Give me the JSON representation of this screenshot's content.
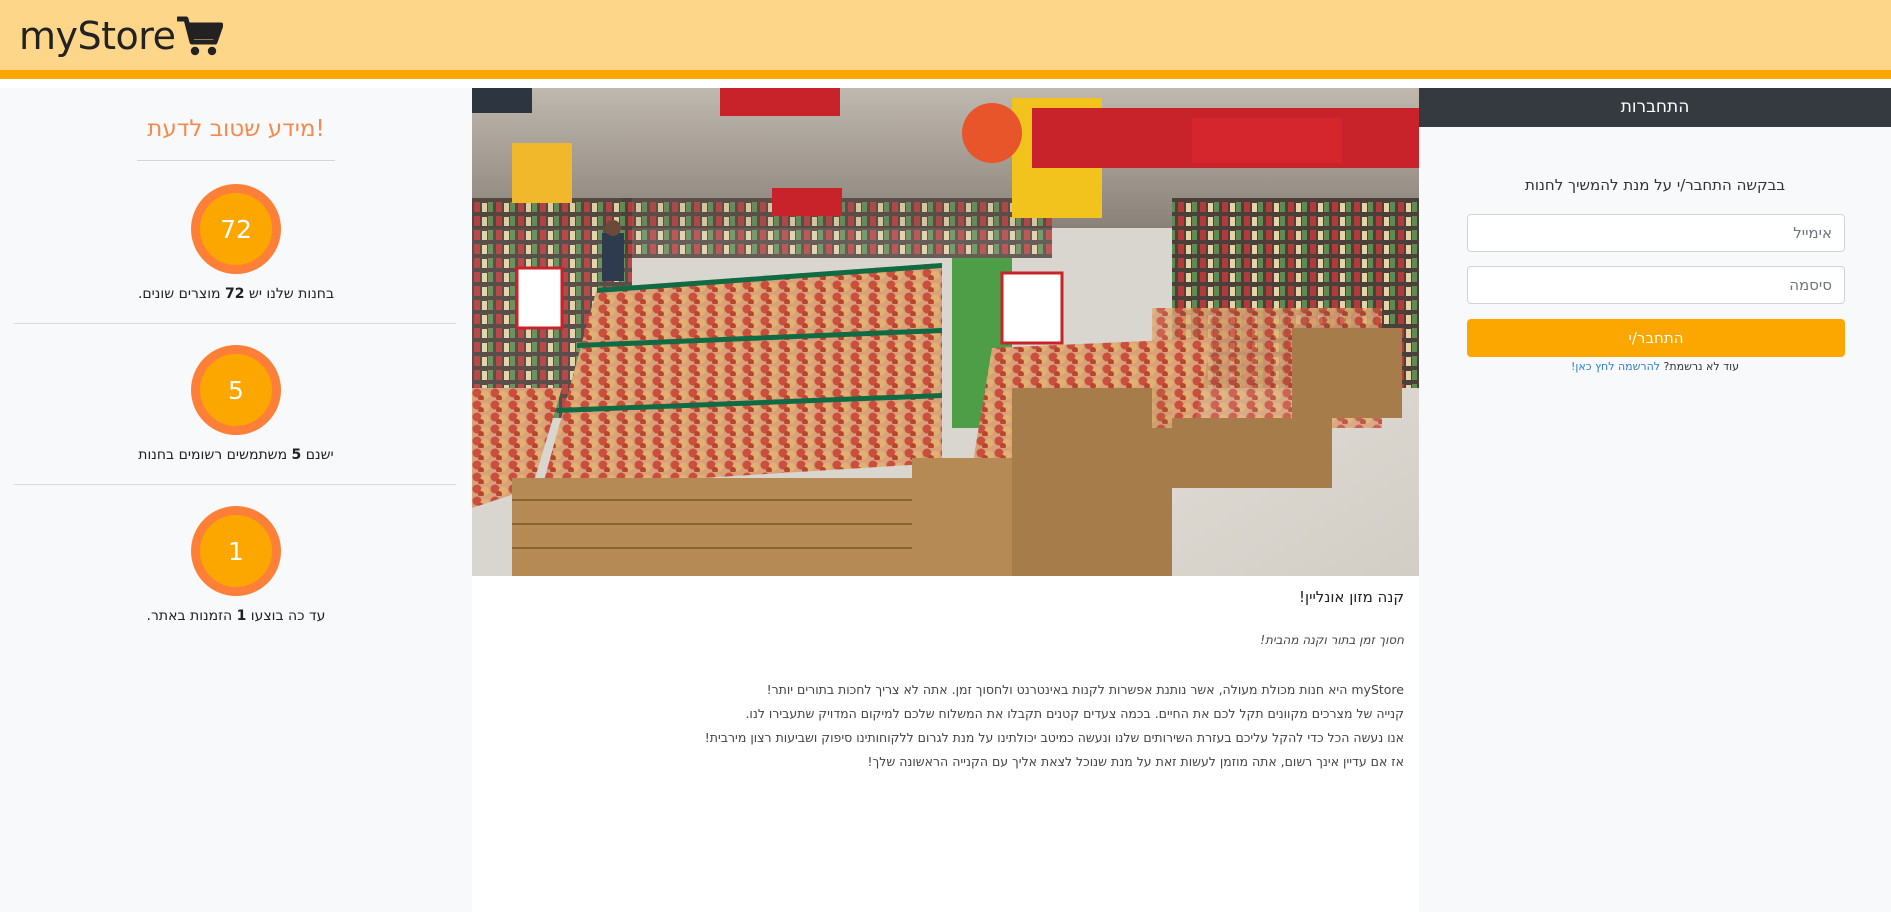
{
  "navbar": {
    "brand": "myStore",
    "cart_icon": "shopping-cart-icon",
    "bg_color": "#fed68a",
    "accent_color": "#fca600"
  },
  "stats": {
    "title": "מידע שטוב לדעת!",
    "items": [
      {
        "value": "72",
        "before": "בחנות שלנו יש ",
        "bold": "72",
        "after": " מוצרים שונים."
      },
      {
        "value": "5",
        "before": "ישנם ",
        "bold": "5",
        "after": " משתמשים רשומים בחנות"
      },
      {
        "value": "1",
        "before": "עד כה בוצעו ",
        "bold": "1",
        "after": " הזמנות באתר."
      }
    ]
  },
  "main": {
    "hero_image": "supermarket-produce-photo",
    "title": "קנה מזון אונליין!",
    "subtitle": "חסוך זמן בתור וקנה מהבית!",
    "paragraphs": [
      "myStore היא חנות מכולת מעולה, אשר נותנת אפשרות לקנות באינטרנט ולחסוך זמן. אתה לא צריך לחכות בתורים יותר!",
      "קנייה של מצרכים מקוונים תקל לכם את החיים. בכמה צעדים קטנים תקבלו את המשלוח שלכם למיקום המדויק שתעבירו לנו.",
      "אנו נעשה הכל כדי להקל עליכם בעזרת השירותים שלנו ונעשה כמיטב יכולתינו על מנת לגרום ללקוחותינו סיפוק ושביעות רצון מירבית!",
      "אז אם עדיין אינך רשום, אתה מוזמן לעשות זאת על מנת שנוכל לצאת אליך עם הקנייה הראשונה שלך!"
    ]
  },
  "login": {
    "header": "התחברות",
    "prompt": "בבקשה התחבר/י על מנת להמשיך לחנות",
    "email_placeholder": "אימייל",
    "email_value": "",
    "password_placeholder": "סיסמה",
    "password_value": "",
    "submit_label": "התחבר/י",
    "register_text": "עוד לא נרשמת?",
    "register_link": "להרשמה לחץ כאן!"
  }
}
